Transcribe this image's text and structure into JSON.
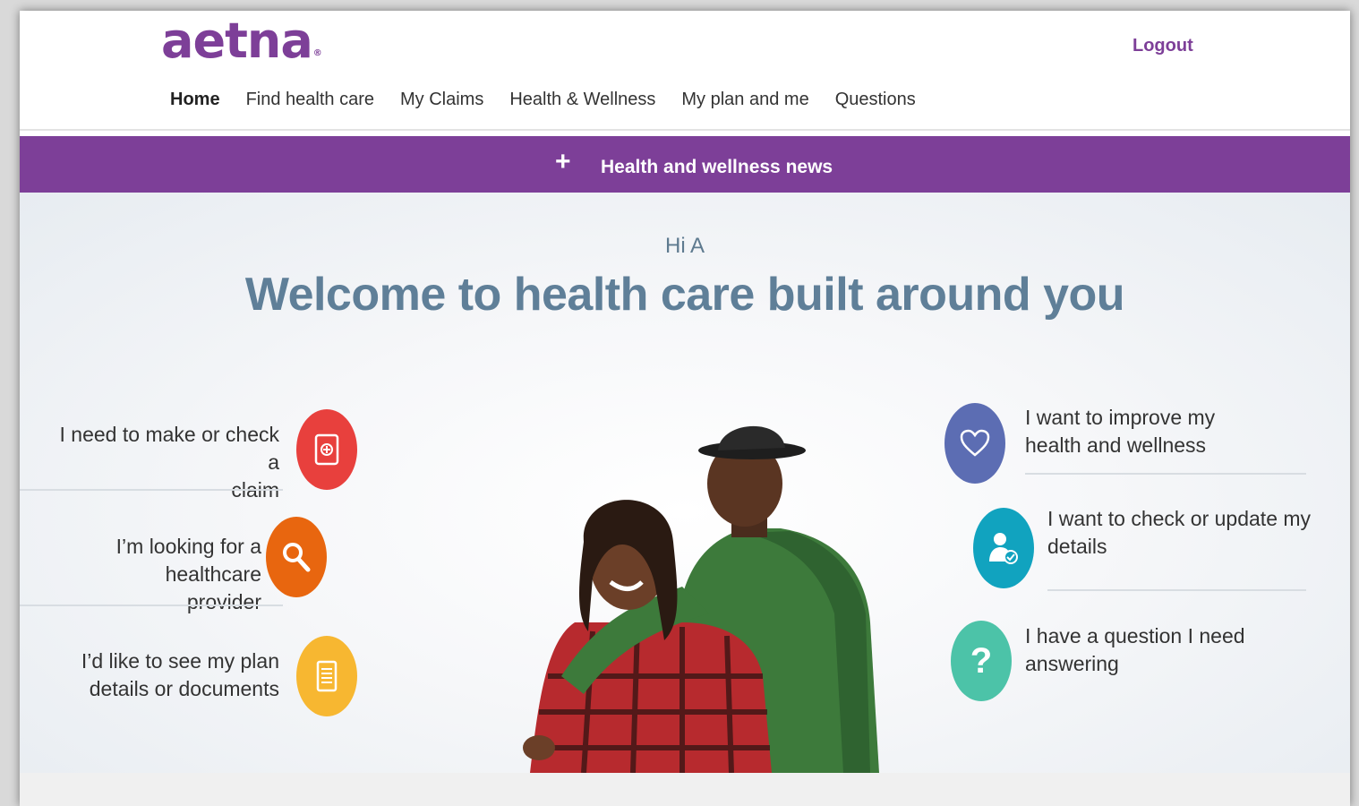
{
  "header": {
    "logo_text": "aetna",
    "logo_mark": "®",
    "logout_label": "Logout",
    "nav": [
      {
        "label": "Home",
        "active": true
      },
      {
        "label": "Find health care"
      },
      {
        "label": "My Claims"
      },
      {
        "label": "Health & Wellness"
      },
      {
        "label": "My plan and me"
      },
      {
        "label": "Questions"
      }
    ]
  },
  "banner": {
    "icon": "plus-icon",
    "text": "Health and wellness news",
    "color": "#7d3f98"
  },
  "hero": {
    "greeting": "Hi A",
    "title": "Welcome to health care built around you"
  },
  "left_options": [
    {
      "line1": "I need to make or check a",
      "line2": "claim",
      "icon": "claim-icon",
      "color": "#e8403d"
    },
    {
      "line1": "I’m looking for a healthcare",
      "line2": "provider",
      "icon": "search-icon",
      "color": "#e8660f"
    },
    {
      "line1": "I’d like to see my plan",
      "line2": "details or documents",
      "icon": "document-icon",
      "color": "#f7b731"
    }
  ],
  "right_options": [
    {
      "line1": "I want to improve my",
      "line2": "health and wellness",
      "icon": "heart-icon",
      "color": "#5c6db3"
    },
    {
      "line1": "I want to check or update my",
      "line2": "details",
      "icon": "user-check-icon",
      "color": "#11a3bf"
    },
    {
      "line1": "I have a question I need",
      "line2": "answering",
      "icon": "question-icon",
      "color": "#4cc3a8"
    }
  ]
}
